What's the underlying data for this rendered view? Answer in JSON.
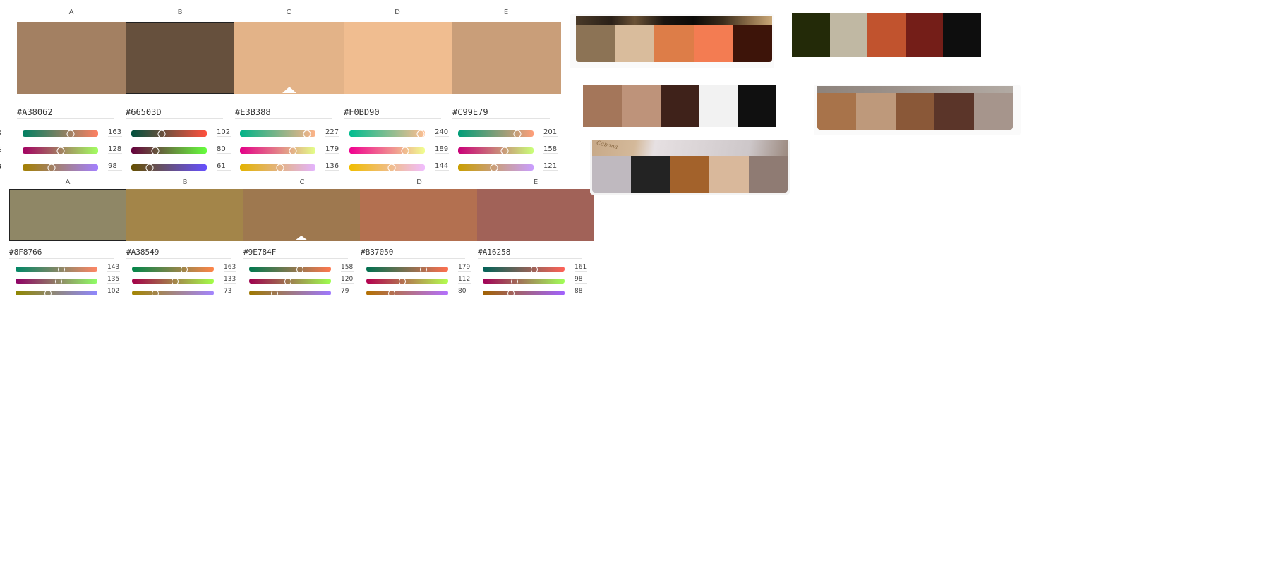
{
  "channel_labels": [
    "R",
    "G",
    "B"
  ],
  "editor1": {
    "letters": [
      "A",
      "B",
      "C",
      "D",
      "E"
    ],
    "selected": 1,
    "caret": 2,
    "swatches": [
      {
        "hex": "#A38062",
        "r": 163,
        "g": 128,
        "b": 98
      },
      {
        "hex": "#66503D",
        "r": 102,
        "g": 80,
        "b": 61
      },
      {
        "hex": "#E3B388",
        "r": 227,
        "g": 179,
        "b": 136
      },
      {
        "hex": "#F0BD90",
        "r": 240,
        "g": 189,
        "b": 144
      },
      {
        "hex": "#C99E79",
        "r": 201,
        "g": 158,
        "b": 121
      }
    ]
  },
  "editor2": {
    "letters": [
      "A",
      "B",
      "C",
      "D",
      "E"
    ],
    "selected": 0,
    "caret": 2,
    "swatches": [
      {
        "hex": "#8F8766",
        "r": 143,
        "g": 135,
        "b": 102
      },
      {
        "hex": "#A38549",
        "r": 163,
        "g": 133,
        "b": 73
      },
      {
        "hex": "#9E784F",
        "r": 158,
        "g": 120,
        "b": 79
      },
      {
        "hex": "#B37050",
        "r": 179,
        "g": 112,
        "b": 80
      },
      {
        "hex": "#A16258",
        "r": 161,
        "g": 98,
        "b": 88
      }
    ]
  },
  "palettes": {
    "p1": [
      "#8c7355",
      "#d9bc9c",
      "#dd7d48",
      "#f37c52",
      "#3d1409"
    ],
    "p2": [
      "#232a08",
      "#c0b8a3",
      "#c1532e",
      "#741e18",
      "#0e0e0e"
    ],
    "p3": [
      "#a4765a",
      "#be937a",
      "#3f221a",
      "#f2f2f2",
      "#101010"
    ],
    "p4": [
      "#a8734a",
      "#be997b",
      "#8a5838",
      "#5b3529",
      "#a6958c"
    ],
    "p5": [
      "#bfb9bf",
      "#232323",
      "#a3622b",
      "#d9b89b",
      "#8f7b73"
    ]
  },
  "photo_text": "Cabana"
}
